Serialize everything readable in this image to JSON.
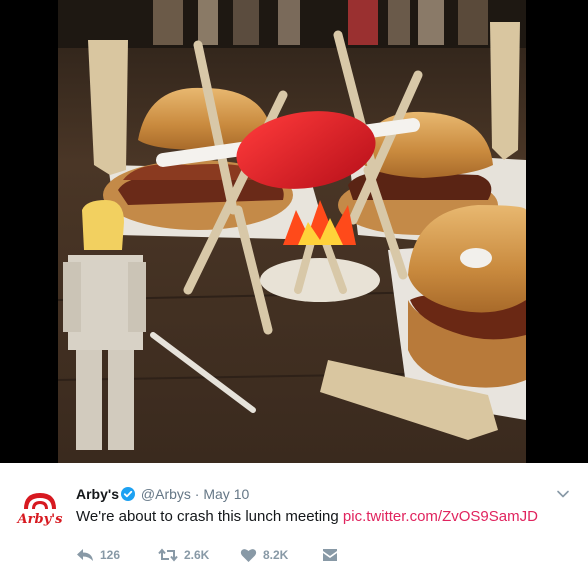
{
  "photo": {
    "alt_icon": "tweet-photo"
  },
  "tweet": {
    "avatar_text": "Arby's",
    "display_name": "Arby's",
    "handle": "@Arbys",
    "separator": "·",
    "date": "May 10",
    "text": "We're about to crash this lunch meeting",
    "link_text": "pic.twitter.com/ZvOS9SamJD",
    "actions": {
      "reply_count": "126",
      "retweet_count": "2.6K",
      "like_count": "8.2K"
    }
  },
  "colors": {
    "brand_red": "#d71920",
    "link": "#e0245e",
    "muted": "#8899a6",
    "verified": "#1da1f2"
  },
  "icons": [
    "reply-icon",
    "retweet-icon",
    "heart-icon",
    "direct-message-icon",
    "chevron-down-icon",
    "verified-badge-icon"
  ]
}
